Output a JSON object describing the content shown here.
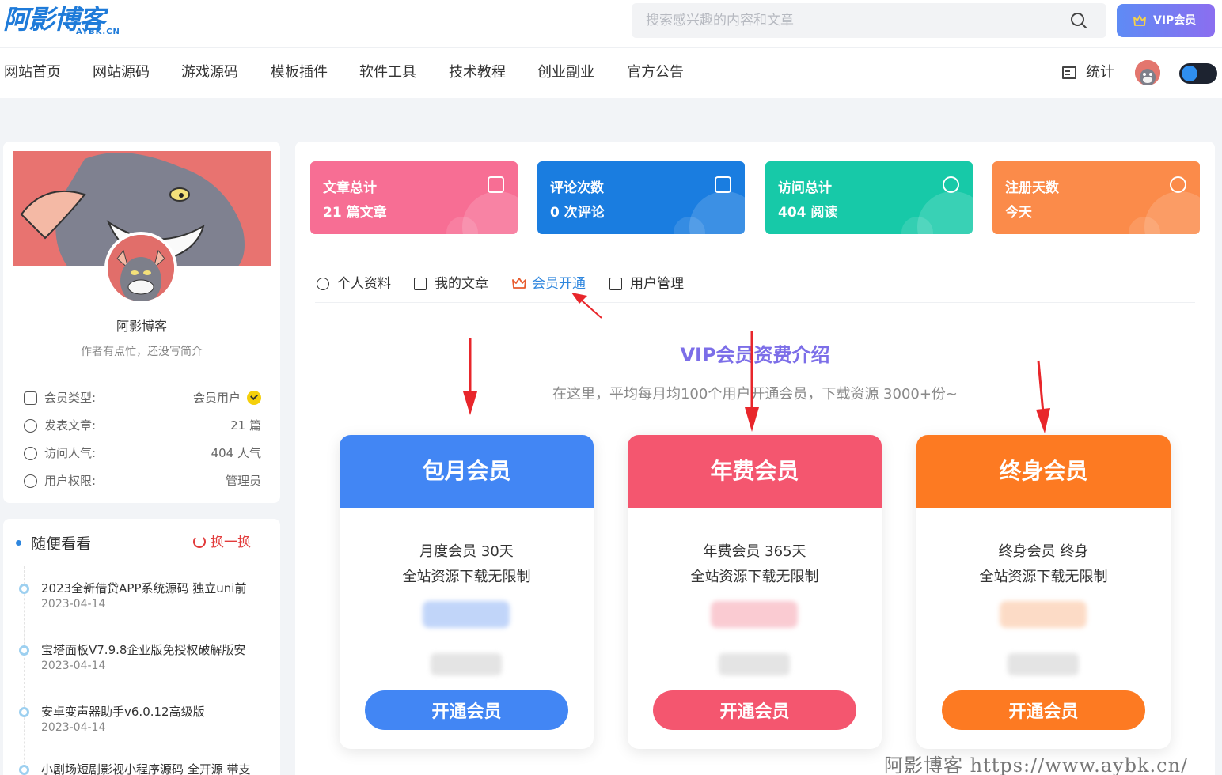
{
  "logo": {
    "main": "阿影博客",
    "sub": "AYBK.CN"
  },
  "search": {
    "placeholder": "搜索感兴趣的内容和文章"
  },
  "vip_button": {
    "label": "VIP会员"
  },
  "nav": [
    "网站首页",
    "网站源码",
    "游戏源码",
    "模板插件",
    "软件工具",
    "技术教程",
    "创业副业",
    "官方公告"
  ],
  "header_stat": {
    "label": "统计"
  },
  "profile": {
    "name": "阿影博客",
    "description": "作者有点忙，还没写简介",
    "rows": [
      {
        "label": "会员类型:",
        "value": "会员用户",
        "icon": "id-card-icon"
      },
      {
        "label": "发表文章:",
        "value": "21 篇",
        "icon": "pen-icon"
      },
      {
        "label": "访问人气:",
        "value": "404 人气",
        "icon": "eye-icon"
      },
      {
        "label": "用户权限:",
        "value": "管理员",
        "icon": "login-icon"
      }
    ]
  },
  "random": {
    "title": "随便看看",
    "swap_label": "换一换",
    "items": [
      {
        "title": "2023全新借贷APP系统源码 独立uni前",
        "date": "2023-04-14"
      },
      {
        "title": "宝塔面板V7.9.8企业版免授权破解版安",
        "date": "2023-04-14"
      },
      {
        "title": "安卓变声器助手v6.0.12高级版",
        "date": "2023-04-14"
      },
      {
        "title": "小剧场短剧影视小程序源码 全开源 带支",
        "date": ""
      }
    ]
  },
  "stats_cards": [
    {
      "title": "文章总计",
      "value": "21 篇文章",
      "color": "#f76e94",
      "icon": "article-icon"
    },
    {
      "title": "评论次数",
      "value": "0 次评论",
      "color": "#1a7de0",
      "icon": "chat-icon"
    },
    {
      "title": "访问总计",
      "value": "404 阅读",
      "color": "#17c9a8",
      "icon": "eye-icon"
    },
    {
      "title": "注册天数",
      "value": "今天",
      "color": "#fb8b4a",
      "icon": "smile-icon"
    }
  ],
  "tabs": [
    {
      "label": "个人资料",
      "icon": "user-icon",
      "active": false
    },
    {
      "label": "我的文章",
      "icon": "file-icon",
      "active": false
    },
    {
      "label": "会员开通",
      "icon": "crown-icon",
      "active": true
    },
    {
      "label": "用户管理",
      "icon": "window-icon",
      "active": false
    }
  ],
  "vip": {
    "title": "VIP会员资费介绍",
    "subtitle": "在这里，平均每月均100个用户开通会员，下载资源 3000+份~"
  },
  "plans": [
    {
      "name": "包月会员",
      "line1": "月度会员 30天",
      "line2": "全站资源下载无限制",
      "button": "开通会员",
      "color": "#4286f4"
    },
    {
      "name": "年费会员",
      "line1": "年费会员 365天",
      "line2": "全站资源下载无限制",
      "button": "开通会员",
      "color": "#f4566f"
    },
    {
      "name": "终身会员",
      "line1": "终身会员 终身",
      "line2": "全站资源下载无限制",
      "button": "开通会员",
      "color": "#fd7a22"
    }
  ],
  "watermark": "阿影博客 https://www.aybk.cn/"
}
